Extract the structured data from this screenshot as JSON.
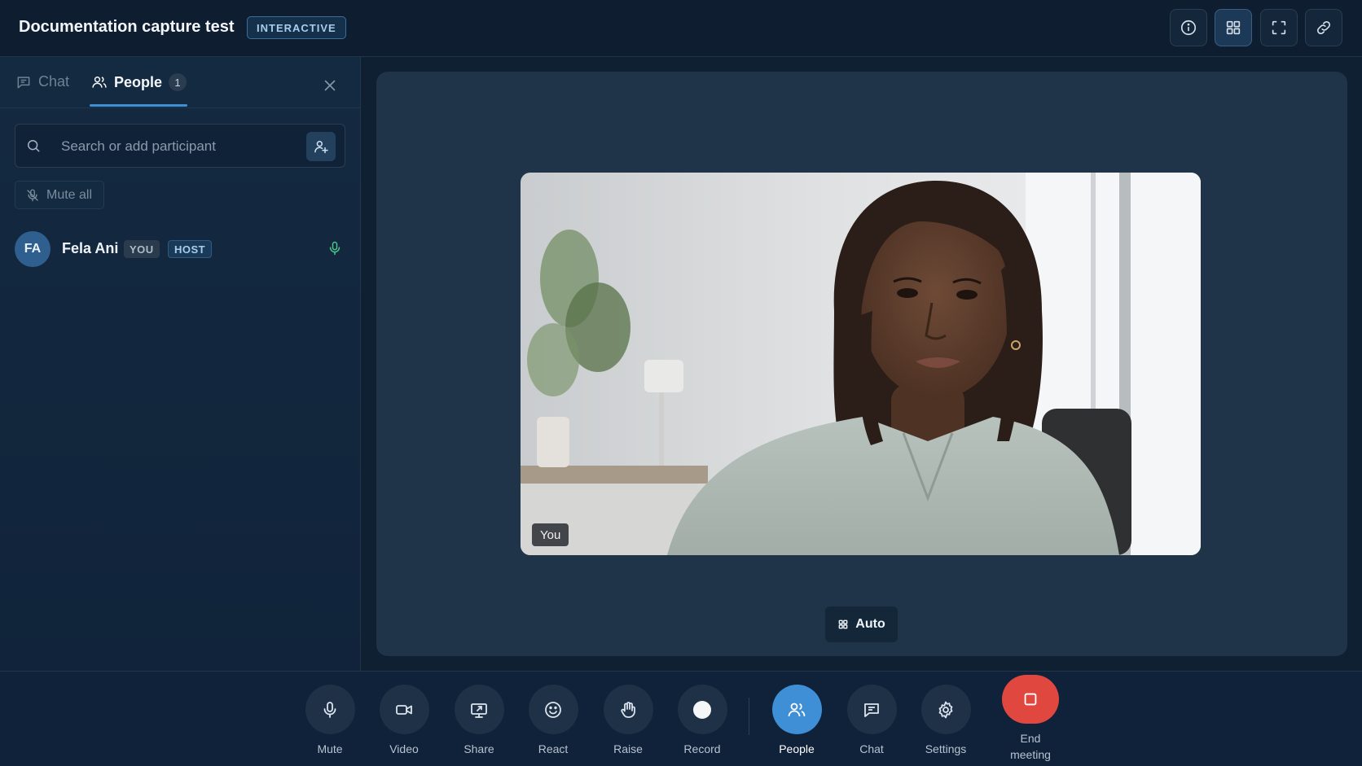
{
  "header": {
    "title": "Documentation capture test",
    "badge": "INTERACTIVE",
    "buttons": [
      {
        "icon": "info-icon"
      },
      {
        "icon": "grid-icon",
        "active": true
      },
      {
        "icon": "fullscreen-icon"
      },
      {
        "icon": "link-icon"
      }
    ]
  },
  "sidebar": {
    "tabs": [
      {
        "label": "Chat",
        "icon": "chat-icon"
      },
      {
        "label": "People",
        "icon": "people-icon",
        "count": "1",
        "selected": true
      }
    ],
    "search": {
      "placeholder": "Search or add participant",
      "value": ""
    },
    "mute_all_label": "Mute all",
    "participants": [
      {
        "initials": "FA",
        "name": "Fela Ani",
        "tags": [
          "YOU",
          "HOST"
        ],
        "mic": "on"
      }
    ]
  },
  "stage": {
    "video_label": "You",
    "layout_button": "Auto"
  },
  "controls": [
    {
      "label": "Mute",
      "icon": "microphone-icon"
    },
    {
      "label": "Video",
      "icon": "video-camera-icon"
    },
    {
      "label": "Share",
      "icon": "screen-share-icon"
    },
    {
      "label": "React",
      "icon": "smiley-icon"
    },
    {
      "label": "Raise",
      "icon": "raise-hand-icon"
    },
    {
      "label": "Record",
      "icon": "record-icon"
    },
    {
      "label": "People",
      "icon": "people-icon",
      "active": true
    },
    {
      "label": "Chat",
      "icon": "chat-icon"
    },
    {
      "label": "Settings",
      "icon": "gear-icon"
    },
    {
      "label": "End\nmeeting",
      "icon": "stop-icon"
    }
  ],
  "colors": {
    "accent": "#3e8fd6",
    "end_meeting": "#e0483f",
    "mic_on": "#4cc38a"
  }
}
